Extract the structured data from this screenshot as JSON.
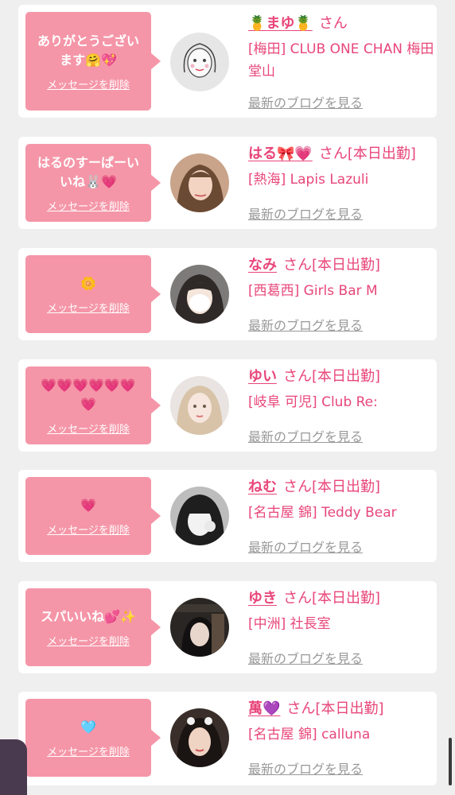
{
  "colors": {
    "accent": "#e8467a",
    "bubble": "#f596a8",
    "muted": "#999999",
    "background": "#efefef"
  },
  "entries": [
    {
      "message": "ありがとうござい\nます🤗💖",
      "delete_label": "メッセージを削除",
      "avatar_icon": "sketch-portrait-avatar",
      "name": "🍍まゆ🍍",
      "san": "さん",
      "status": "",
      "shop": "[梅田] CLUB ONE CHAN 梅田堂山",
      "blog_label": "最新のブログを見る"
    },
    {
      "message": "はるのすーぱーい\nいね🐰💗",
      "delete_label": "メッセージを削除",
      "avatar_icon": "photo-avatar",
      "name": "はる🎀💗",
      "san": "さん",
      "status": "[本日出勤]",
      "shop": "[熱海] Lapis Lazuli",
      "blog_label": "最新のブログを見る"
    },
    {
      "message": "🌼",
      "delete_label": "メッセージを削除",
      "avatar_icon": "photo-avatar",
      "name": "なみ",
      "san": "さん",
      "status": "[本日出勤]",
      "shop": "[西葛西] Girls Bar M",
      "blog_label": "最新のブログを見る"
    },
    {
      "message": "💗💗💗💗💗💗\n💗",
      "delete_label": "メッセージを削除",
      "avatar_icon": "photo-avatar",
      "name": "ゆい",
      "san": "さん",
      "status": "[本日出勤]",
      "shop": "[岐阜 可児] Club Re:",
      "blog_label": "最新のブログを見る"
    },
    {
      "message": "💗",
      "delete_label": "メッセージを削除",
      "avatar_icon": "photo-avatar",
      "name": "ねむ",
      "san": "さん",
      "status": "[本日出勤]",
      "shop": "[名古屋 錦] Teddy Bear",
      "blog_label": "最新のブログを見る"
    },
    {
      "message": "スパいいね💕✨",
      "delete_label": "メッセージを削除",
      "avatar_icon": "photo-avatar",
      "name": "ゆき",
      "san": "さん",
      "status": "[本日出勤]",
      "shop": "[中洲] 社長室",
      "blog_label": "最新のブログを見る"
    },
    {
      "message": "🩵",
      "delete_label": "メッセージを削除",
      "avatar_icon": "photo-avatar",
      "name": "萬💜",
      "san": "さん",
      "status": "[本日出勤]",
      "shop": "[名古屋 錦] calluna",
      "blog_label": "最新のブログを見る"
    }
  ]
}
